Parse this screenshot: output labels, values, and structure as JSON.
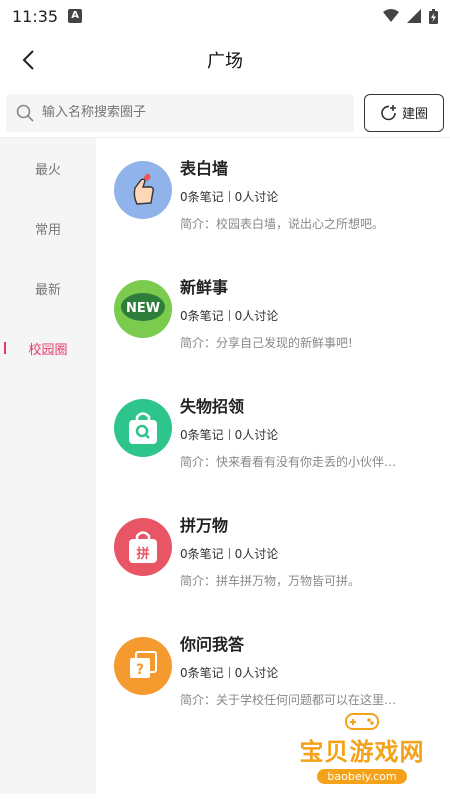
{
  "status_bar": {
    "time": "11:35",
    "app_badge": "A"
  },
  "nav": {
    "title": "广场"
  },
  "search": {
    "placeholder": "输入名称搜索圈子",
    "create_label": "建圈"
  },
  "sidebar": {
    "items": [
      {
        "label": "最火",
        "active": false
      },
      {
        "label": "常用",
        "active": false
      },
      {
        "label": "最新",
        "active": false
      },
      {
        "label": "校园圈",
        "active": true
      }
    ]
  },
  "circles": [
    {
      "name": "表白墙",
      "notes": "0条笔记",
      "discussions": "0人讨论",
      "desc": "简介：校园表白墙，说出心之所想吧。",
      "icon": "finger-heart-icon",
      "color": "#8fb3ea"
    },
    {
      "name": "新鲜事",
      "notes": "0条笔记",
      "discussions": "0人讨论",
      "desc": "简介：分享自己发现的新鲜事吧!",
      "icon": "new-bubble-icon",
      "color": "#7acb4e",
      "icon_text": "NEW"
    },
    {
      "name": "失物招领",
      "notes": "0条笔记",
      "discussions": "0人讨论",
      "desc": "简介：快来看看有没有你走丢的小伙伴…",
      "icon": "bag-search-icon",
      "color": "#2ec58c"
    },
    {
      "name": "拼万物",
      "notes": "0条笔记",
      "discussions": "0人讨论",
      "desc": "简介：拼车拼万物，万物皆可拼。",
      "icon": "pin-bag-icon",
      "color": "#e85564",
      "icon_text": "拼"
    },
    {
      "name": "你问我答",
      "notes": "0条笔记",
      "discussions": "0人讨论",
      "desc": "简介：关于学校任何问题都可以在这里…",
      "icon": "question-icon",
      "color": "#f59a2e",
      "icon_text": "?"
    }
  ],
  "watermark": {
    "text": "宝贝游戏网",
    "url": "baobeiy.com"
  }
}
